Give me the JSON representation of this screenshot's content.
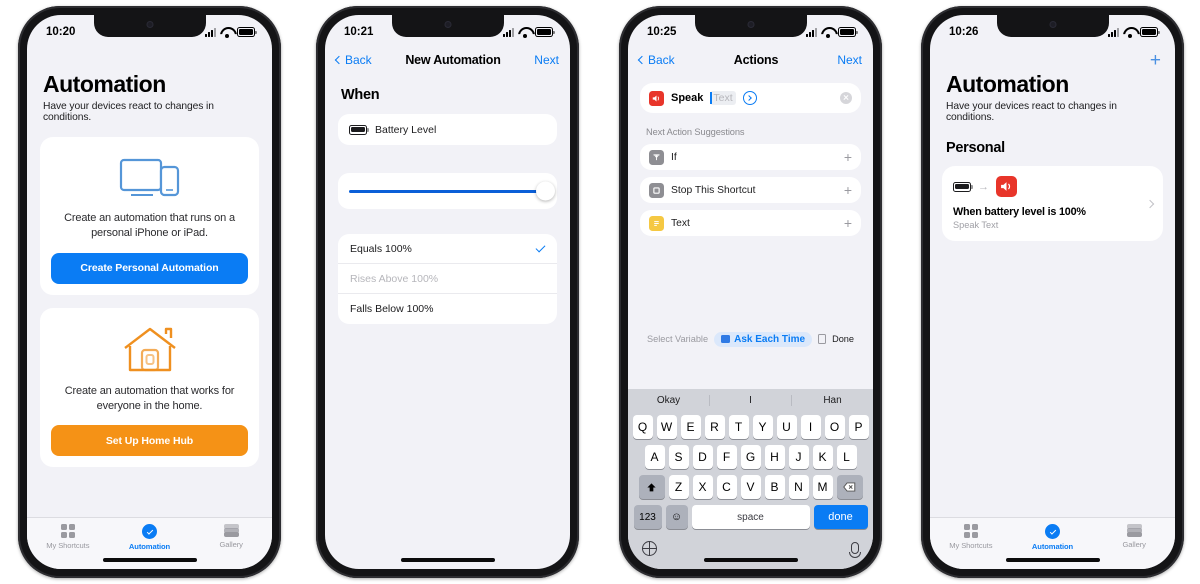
{
  "phones": [
    {
      "id": "automation-empty",
      "status": {
        "time": "10:20",
        "signal": "cellular-bars",
        "wifi": "wifi-icon",
        "battery": "battery-icon"
      },
      "title": "Automation",
      "subtitle": "Have your devices react to changes in conditions.",
      "cards": [
        {
          "icon": "ipad-iphone-icon",
          "text": "Create an automation that runs on a personal iPhone or iPad.",
          "button": "Create Personal Automation",
          "button_color": "#0a7cf4"
        },
        {
          "icon": "home-house-icon",
          "text": "Create an automation that works for everyone in the home.",
          "button": "Set Up Home Hub",
          "button_color": "#f59216"
        }
      ],
      "tabs": [
        {
          "label": "My Shortcuts",
          "icon": "grid-icon",
          "active": false
        },
        {
          "label": "Automation",
          "icon": "automation-check-icon",
          "active": true
        },
        {
          "label": "Gallery",
          "icon": "layers-icon",
          "active": false
        }
      ]
    },
    {
      "id": "new-automation",
      "status": {
        "time": "10:21"
      },
      "nav": {
        "back": "Back",
        "title": "New Automation",
        "next": "Next"
      },
      "section": "When",
      "trigger": {
        "icon": "battery-icon",
        "label": "Battery Level"
      },
      "slider": {
        "value": 100,
        "min": 0,
        "max": 100
      },
      "options": [
        {
          "label": "Equals 100%",
          "selected": true,
          "dim": false
        },
        {
          "label": "Rises Above 100%",
          "selected": false,
          "dim": true
        },
        {
          "label": "Falls Below 100%",
          "selected": false,
          "dim": false
        }
      ]
    },
    {
      "id": "actions",
      "status": {
        "time": "10:25"
      },
      "nav": {
        "back": "Back",
        "title": "Actions",
        "next": "Next"
      },
      "action": {
        "icon": "speak-icon",
        "label": "Speak",
        "placeholder": "Text"
      },
      "suggestions_header": "Next Action Suggestions",
      "suggestions": [
        {
          "label": "If",
          "icon": "if-icon",
          "add": "+"
        },
        {
          "label": "Stop This Shortcut",
          "icon": "stop-icon",
          "add": "+"
        },
        {
          "label": "Text",
          "icon": "text-icon",
          "add": "+"
        }
      ],
      "varbar": {
        "select_variable": "Select Variable",
        "ask_each_time": "Ask Each Time",
        "clipboard": "clipboard-icon",
        "done": "Done"
      },
      "keyboard": {
        "suggestions": [
          "Okay",
          "I",
          "Han"
        ],
        "row1": [
          "Q",
          "W",
          "E",
          "R",
          "T",
          "Y",
          "U",
          "I",
          "O",
          "P"
        ],
        "row2": [
          "A",
          "S",
          "D",
          "F",
          "G",
          "H",
          "J",
          "K",
          "L"
        ],
        "row3": [
          "Z",
          "X",
          "C",
          "V",
          "B",
          "N",
          "M"
        ],
        "shift": "shift-icon",
        "backspace": "backspace-icon",
        "numbers": "123",
        "emoji": "emoji-icon",
        "space": "space",
        "done": "done",
        "globe": "globe-icon",
        "mic": "microphone-icon"
      }
    },
    {
      "id": "automation-list",
      "status": {
        "time": "10:26"
      },
      "add_button": "+",
      "title": "Automation",
      "subtitle": "Have your devices react to changes in conditions.",
      "group_header": "Personal",
      "items": [
        {
          "trigger_icon": "battery-icon",
          "arrow": "→",
          "action_icon": "speak-icon",
          "title": "When battery level is 100%",
          "subtitle": "Speak Text"
        }
      ],
      "tabs": [
        {
          "label": "My Shortcuts",
          "icon": "grid-icon",
          "active": false
        },
        {
          "label": "Automation",
          "icon": "automation-check-icon",
          "active": true
        },
        {
          "label": "Gallery",
          "icon": "layers-icon",
          "active": false
        }
      ]
    }
  ]
}
